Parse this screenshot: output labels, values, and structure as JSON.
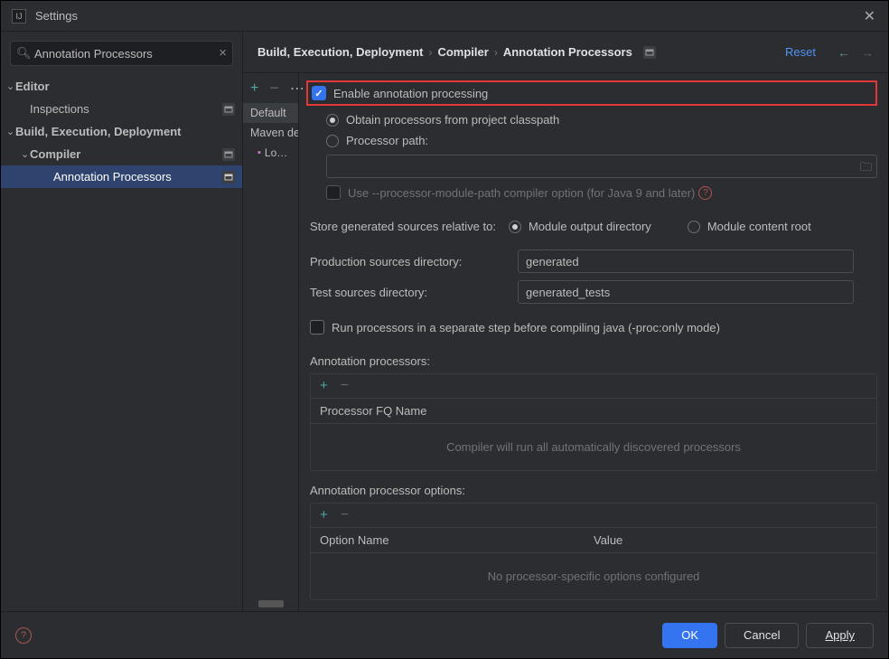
{
  "title": "Settings",
  "search": {
    "value": "Annotation Processors"
  },
  "sidebar": {
    "items": [
      {
        "label": "Editor",
        "lvl": 0,
        "expand": true,
        "bold": true
      },
      {
        "label": "Inspections",
        "lvl": 1,
        "normal": true,
        "badge": true
      },
      {
        "label": "Build, Execution, Deployment",
        "lvl": 0,
        "expand": true,
        "bold": true
      },
      {
        "label": "Compiler",
        "lvl": 1,
        "expand": true,
        "bold": true,
        "badge": true
      },
      {
        "label": "Annotation Processors",
        "lvl": 2,
        "selected": true,
        "normal": true,
        "badge": true
      }
    ]
  },
  "breadcrumbs": [
    "Build, Execution, Deployment",
    "Compiler",
    "Annotation Processors"
  ],
  "reset": "Reset",
  "profiles": {
    "default": "Default",
    "maven": "Maven default ann…",
    "sub": "Lo…"
  },
  "form": {
    "enable": "Enable annotation processing",
    "obtain": "Obtain processors from project classpath",
    "procpath": "Processor path:",
    "pathvalue": "",
    "modulepath_l1": "Use --processor-module-path compiler option (for Java 9 and later)",
    "storelabel": "Store generated sources relative to:",
    "store_opt1": "Module output directory",
    "store_opt2": "Module content root",
    "prodlabel": "Production sources directory:",
    "prodvalue": "generated",
    "testlabel": "Test sources directory:",
    "testvalue": "generated_tests",
    "separate": "Run processors in a separate step before compiling java (-proc:only mode)",
    "ap_title": "Annotation processors:",
    "ap_col": "Processor FQ Name",
    "ap_empty": "Compiler will run all automatically discovered processors",
    "opt_title": "Annotation processor options:",
    "opt_col1": "Option Name",
    "opt_col2": "Value",
    "opt_empty": "No processor-specific options configured"
  },
  "buttons": {
    "ok": "OK",
    "cancel": "Cancel",
    "apply": "Apply"
  }
}
